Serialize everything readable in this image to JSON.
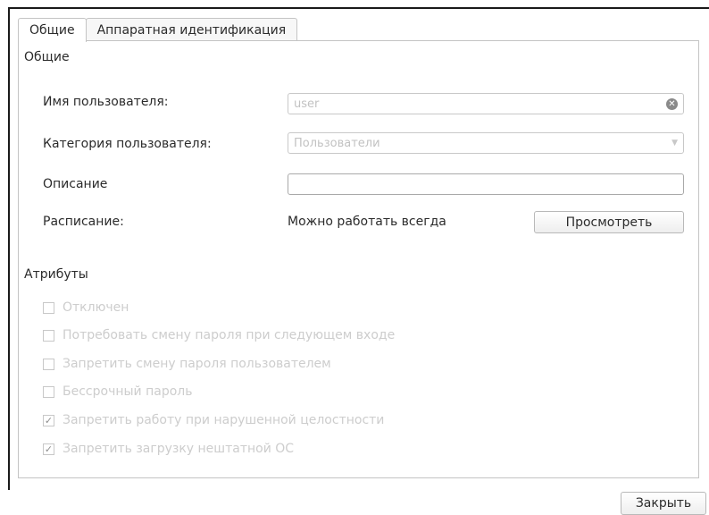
{
  "tabs": [
    {
      "label": "Общие"
    },
    {
      "label": "Аппаратная идентификация"
    }
  ],
  "general": {
    "section_title": "Общие",
    "username_label": "Имя пользователя:",
    "username_value": "user",
    "category_label": "Категория пользователя:",
    "category_value": "Пользователи",
    "description_label": "Описание",
    "description_value": "",
    "schedule_label": "Расписание:",
    "schedule_value": "Можно работать всегда",
    "view_button": "Просмотреть"
  },
  "attributes": {
    "section_title": "Атрибуты",
    "items": [
      {
        "label": "Отключен",
        "checked": false
      },
      {
        "label": "Потребовать смену пароля при следующем входе",
        "checked": false
      },
      {
        "label": "Запретить смену пароля пользователем",
        "checked": false
      },
      {
        "label": "Бессрочный пароль",
        "checked": false
      },
      {
        "label": "Запретить работу при нарушенной целостности",
        "checked": true
      },
      {
        "label": "Запретить загрузку нештатной ОС",
        "checked": true
      }
    ]
  },
  "footer": {
    "close_button": "Закрыть"
  },
  "icons": {
    "clear": "clear-icon",
    "dropdown": "chevron-down-icon",
    "check": "checkmark-icon"
  }
}
